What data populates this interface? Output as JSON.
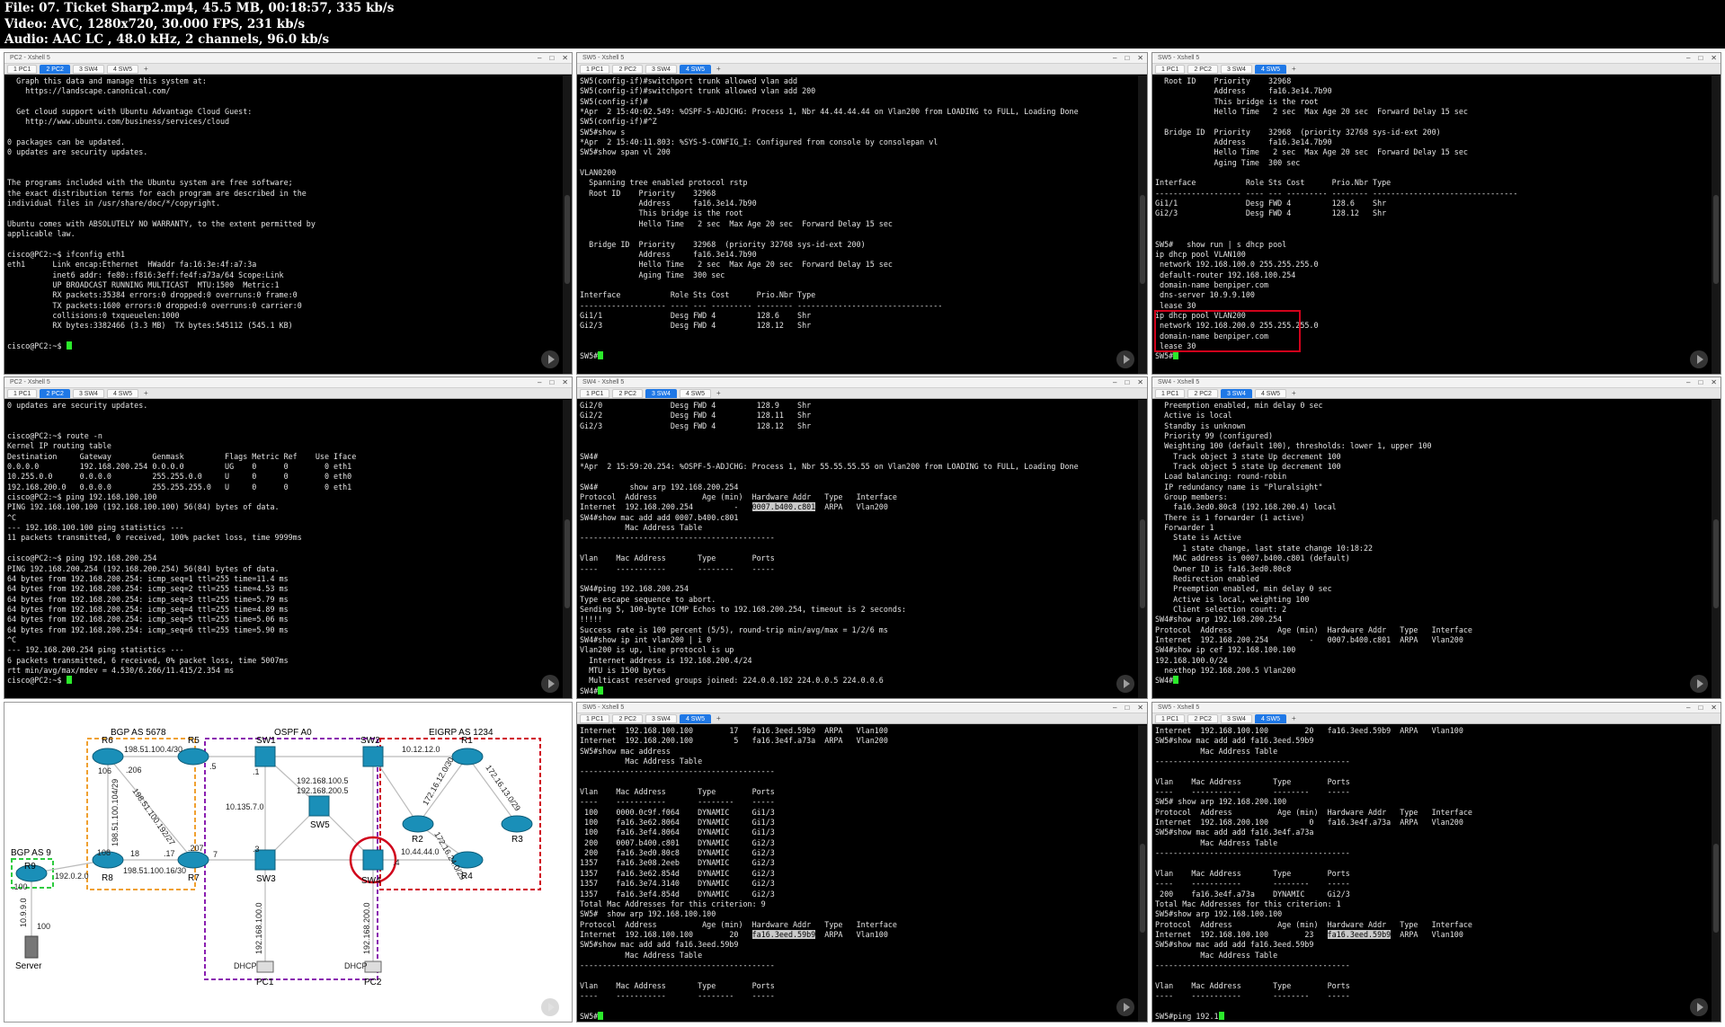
{
  "file_info": [
    "File: 07. Ticket Sharp2.mp4, 45.5 MB, 00:18:57, 335 kb/s",
    "Video: AVC, 1280x720, 30.000 FPS, 231 kb/s",
    "Audio: AAC LC , 48.0 kHz, 2 channels, 96.0 kb/s"
  ],
  "panes": [
    {
      "title": "PC2 - Xshell 5",
      "tabs": [
        "1 PC1",
        "2 PC2",
        "3 SW4",
        "4 SW5"
      ],
      "active_tab": 1,
      "lines": [
        "  Graph this data and manage this system at:",
        "    https://landscape.canonical.com/",
        "",
        "  Get cloud support with Ubuntu Advantage Cloud Guest:",
        "    http://www.ubuntu.com/business/services/cloud",
        "",
        "0 packages can be updated.",
        "0 updates are security updates.",
        "",
        "",
        "The programs included with the Ubuntu system are free software;",
        "the exact distribution terms for each program are described in the",
        "individual files in /usr/share/doc/*/copyright.",
        "",
        "Ubuntu comes with ABSOLUTELY NO WARRANTY, to the extent permitted by",
        "applicable law.",
        "",
        "cisco@PC2:~$ ifconfig eth1",
        "eth1      Link encap:Ethernet  HWaddr fa:16:3e:4f:a7:3a",
        "          inet6 addr: fe80::f816:3eff:fe4f:a73a/64 Scope:Link",
        "          UP BROADCAST RUNNING MULTICAST  MTU:1500  Metric:1",
        "          RX packets:35384 errors:0 dropped:0 overruns:0 frame:0",
        "          TX packets:1600 errors:0 dropped:0 overruns:0 carrier:0",
        "          collisions:0 txqueuelen:1000",
        "          RX bytes:3382466 (3.3 MB)  TX bytes:545112 (545.1 KB)",
        "",
        "cisco@PC2:~$ "
      ]
    },
    {
      "title": "SW5 - Xshell 5",
      "tabs": [
        "1 PC1",
        "2 PC2",
        "3 SW4",
        "4 SW5"
      ],
      "active_tab": 3,
      "lines": [
        "SW5(config-if)#switchport trunk allowed vlan add",
        "SW5(config-if)#switchport trunk allowed vlan add 200",
        "SW5(config-if)#",
        "*Apr  2 15:40:02.549: %OSPF-5-ADJCHG: Process 1, Nbr 44.44.44.44 on Vlan200 from LOADING to FULL, Loading Done",
        "SW5(config-if)#^Z",
        "SW5#show s",
        "*Apr  2 15:40:11.803: %SYS-5-CONFIG_I: Configured from console by consolepan vl",
        "SW5#show span vl 200",
        "",
        "VLAN0200",
        "  Spanning tree enabled protocol rstp",
        "  Root ID    Priority    32968",
        "             Address     fa16.3e14.7b90",
        "             This bridge is the root",
        "             Hello Time   2 sec  Max Age 20 sec  Forward Delay 15 sec",
        "",
        "  Bridge ID  Priority    32968  (priority 32768 sys-id-ext 200)",
        "             Address     fa16.3e14.7b90",
        "             Hello Time   2 sec  Max Age 20 sec  Forward Delay 15 sec",
        "             Aging Time  300 sec",
        "",
        "Interface           Role Sts Cost      Prio.Nbr Type",
        "------------------- ---- --- --------- -------- --------------------------------",
        "Gi1/1               Desg FWD 4         128.6    Shr",
        "Gi2/3               Desg FWD 4         128.12   Shr",
        "",
        "",
        "SW5#"
      ]
    },
    {
      "title": "SW5 - Xshell 5",
      "tabs": [
        "1 PC1",
        "2 PC2",
        "3 SW4",
        "4 SW5"
      ],
      "active_tab": 3,
      "lines": [
        "  Root ID    Priority    32968",
        "             Address     fa16.3e14.7b90",
        "             This bridge is the root",
        "             Hello Time   2 sec  Max Age 20 sec  Forward Delay 15 sec",
        "",
        "  Bridge ID  Priority    32968  (priority 32768 sys-id-ext 200)",
        "             Address     fa16.3e14.7b90",
        "             Hello Time   2 sec  Max Age 20 sec  Forward Delay 15 sec",
        "             Aging Time  300 sec",
        "",
        "Interface           Role Sts Cost      Prio.Nbr Type",
        "------------------- ---- --- --------- -------- --------------------------------",
        "Gi1/1               Desg FWD 4         128.6    Shr",
        "Gi2/3               Desg FWD 4         128.12   Shr",
        "",
        "",
        "SW5#   show run | s dhcp pool",
        "ip dhcp pool VLAN100",
        " network 192.168.100.0 255.255.255.0",
        " default-router 192.168.100.254",
        " domain-name benpiper.com",
        " dns-server 10.9.9.100",
        " lease 30",
        "ip dhcp pool VLAN200",
        " network 192.168.200.0 255.255.255.0",
        " domain-name benpiper.com",
        " lease 30",
        "SW5#"
      ]
    },
    {
      "title": "PC2 - Xshell 5",
      "tabs": [
        "1 PC1",
        "2 PC2",
        "3 SW4",
        "4 SW5"
      ],
      "active_tab": 1,
      "lines": [
        "0 updates are security updates.",
        "",
        "",
        "cisco@PC2:~$ route -n",
        "Kernel IP routing table",
        "Destination     Gateway         Genmask         Flags Metric Ref    Use Iface",
        "0.0.0.0         192.168.200.254 0.0.0.0         UG    0      0        0 eth1",
        "10.255.0.0      0.0.0.0         255.255.0.0     U     0      0        0 eth0",
        "192.168.200.0   0.0.0.0         255.255.255.0   U     0      0        0 eth1",
        "cisco@PC2:~$ ping 192.168.100.100",
        "PING 192.168.100.100 (192.168.100.100) 56(84) bytes of data.",
        "^C",
        "--- 192.168.100.100 ping statistics ---",
        "11 packets transmitted, 0 received, 100% packet loss, time 9999ms",
        "",
        "cisco@PC2:~$ ping 192.168.200.254",
        "PING 192.168.200.254 (192.168.200.254) 56(84) bytes of data.",
        "64 bytes from 192.168.200.254: icmp_seq=1 ttl=255 time=11.4 ms",
        "64 bytes from 192.168.200.254: icmp_seq=2 ttl=255 time=4.53 ms",
        "64 bytes from 192.168.200.254: icmp_seq=3 ttl=255 time=5.79 ms",
        "64 bytes from 192.168.200.254: icmp_seq=4 ttl=255 time=4.89 ms",
        "64 bytes from 192.168.200.254: icmp_seq=5 ttl=255 time=5.06 ms",
        "64 bytes from 192.168.200.254: icmp_seq=6 ttl=255 time=5.90 ms",
        "^C",
        "--- 192.168.200.254 ping statistics ---",
        "6 packets transmitted, 6 received, 0% packet loss, time 5007ms",
        "rtt min/avg/max/mdev = 4.530/6.266/11.415/2.354 ms",
        "cisco@PC2:~$ "
      ]
    },
    {
      "title": "SW4 - Xshell 5",
      "tabs": [
        "1 PC1",
        "2 PC2",
        "3 SW4",
        "4 SW5"
      ],
      "active_tab": 2,
      "lines": [
        "Gi2/0               Desg FWD 4         128.9    Shr",
        "Gi2/2               Desg FWD 4         128.11   Shr",
        "Gi2/3               Desg FWD 4         128.12   Shr",
        "",
        "",
        "SW4#",
        "*Apr  2 15:59:20.254: %OSPF-5-ADJCHG: Process 1, Nbr 55.55.55.55 on Vlan200 from LOADING to FULL, Loading Done",
        "",
        "SW4#       show arp 192.168.200.254",
        "Protocol  Address          Age (min)  Hardware Addr   Type   Interface",
        "Internet  192.168.200.254         -   0007.b400.c801  ARPA   Vlan200",
        "SW4#show mac add add 0007.b400.c801",
        "          Mac Address Table",
        "-------------------------------------------",
        "",
        "Vlan    Mac Address       Type        Ports",
        "----    -----------       --------    -----",
        "",
        "SW4#ping 192.168.200.254",
        "Type escape sequence to abort.",
        "Sending 5, 100-byte ICMP Echos to 192.168.200.254, timeout is 2 seconds:",
        "!!!!!",
        "Success rate is 100 percent (5/5), round-trip min/avg/max = 1/2/6 ms",
        "SW4#show ip int vlan200 | i 0",
        "Vlan200 is up, line protocol is up",
        "  Internet address is 192.168.200.4/24",
        "  MTU is 1500 bytes",
        "  Multicast reserved groups joined: 224.0.0.102 224.0.0.5 224.0.0.6",
        "SW4#"
      ]
    },
    {
      "title": "SW4 - Xshell 5",
      "tabs": [
        "1 PC1",
        "2 PC2",
        "3 SW4",
        "4 SW5"
      ],
      "active_tab": 2,
      "lines": [
        "  Preemption enabled, min delay 0 sec",
        "  Active is local",
        "  Standby is unknown",
        "  Priority 99 (configured)",
        "  Weighting 100 (default 100), thresholds: lower 1, upper 100",
        "    Track object 3 state Up decrement 100",
        "    Track object 5 state Up decrement 100",
        "  Load balancing: round-robin",
        "  IP redundancy name is \"Pluralsight\"",
        "  Group members:",
        "    fa16.3ed0.80c8 (192.168.200.4) local",
        "  There is 1 forwarder (1 active)",
        "  Forwarder 1",
        "    State is Active",
        "      1 state change, last state change 10:18:22",
        "    MAC address is 0007.b400.c801 (default)",
        "    Owner ID is fa16.3ed0.80c8",
        "    Redirection enabled",
        "    Preemption enabled, min delay 0 sec",
        "    Active is local, weighting 100",
        "    Client selection count: 2",
        "SW4#show arp 192.168.200.254",
        "Protocol  Address          Age (min)  Hardware Addr   Type   Interface",
        "Internet  192.168.200.254         -   0007.b400.c801  ARPA   Vlan200",
        "SW4#show ip cef 192.168.100.100",
        "192.168.100.0/24",
        "  nexthop 192.168.200.5 Vlan200",
        "SW4#"
      ]
    },
    {
      "title": "SW5 - Xshell 5",
      "tabs": [
        "1 PC1",
        "2 PC2",
        "3 SW4",
        "4 SW5"
      ],
      "active_tab": 3,
      "lines": [
        "Internet  192.168.100.100        17   fa16.3eed.59b9  ARPA   Vlan100",
        "Internet  192.168.200.100         5   fa16.3e4f.a73a  ARPA   Vlan200",
        "SW5#show mac address",
        "          Mac Address Table",
        "-------------------------------------------",
        "",
        "Vlan    Mac Address       Type        Ports",
        "----    -----------       --------    -----",
        " 100    0000.0c9f.f064    DYNAMIC     Gi1/3",
        " 100    fa16.3e62.8064    DYNAMIC     Gi1/3",
        " 100    fa16.3ef4.8064    DYNAMIC     Gi1/3",
        " 200    0007.b400.c801    DYNAMIC     Gi2/3",
        " 200    fa16.3ed0.80c8    DYNAMIC     Gi2/3",
        "1357    fa16.3e08.2eeb    DYNAMIC     Gi2/3",
        "1357    fa16.3e62.854d    DYNAMIC     Gi2/3",
        "1357    fa16.3e74.3140    DYNAMIC     Gi2/3",
        "1357    fa16.3ef4.854d    DYNAMIC     Gi2/3",
        "Total Mac Addresses for this criterion: 9",
        "SW5#  show arp 192.168.100.100",
        "Protocol  Address          Age (min)  Hardware Addr   Type   Interface",
        "Internet  192.168.100.100        20   fa16.3eed.59b9  ARPA   Vlan100",
        "SW5#show mac add add fa16.3eed.59b9",
        "          Mac Address Table",
        "-------------------------------------------",
        "",
        "Vlan    Mac Address       Type        Ports",
        "----    -----------       --------    -----",
        "",
        "SW5#"
      ]
    },
    {
      "title": "SW5 - Xshell 5",
      "tabs": [
        "1 PC1",
        "2 PC2",
        "3 SW4",
        "4 SW5"
      ],
      "active_tab": 3,
      "lines": [
        "Internet  192.168.100.100        20   fa16.3eed.59b9  ARPA   Vlan100",
        "SW5#show mac add add fa16.3eed.59b9",
        "          Mac Address Table",
        "-------------------------------------------",
        "",
        "Vlan    Mac Address       Type        Ports",
        "----    -----------       --------    -----",
        "SW5# show arp 192.168.200.100",
        "Protocol  Address          Age (min)  Hardware Addr   Type   Interface",
        "Internet  192.168.200.100         0   fa16.3e4f.a73a  ARPA   Vlan200",
        "SW5#show mac add add fa16.3e4f.a73a",
        "          Mac Address Table",
        "-------------------------------------------",
        "",
        "Vlan    Mac Address       Type        Ports",
        "----    -----------       --------    -----",
        " 200    fa16.3e4f.a73a    DYNAMIC     Gi2/3",
        "Total Mac Addresses for this criterion: 1",
        "SW5#show arp 192.168.100.100",
        "Protocol  Address          Age (min)  Hardware Addr   Type   Interface",
        "Internet  192.168.100.100        23   fa16.3eed.59b9  ARPA   Vlan100",
        "SW5#show mac add add fa16.3eed.59b9",
        "          Mac Address Table",
        "-------------------------------------------",
        "",
        "Vlan    Mac Address       Type        Ports",
        "----    -----------       --------    -----",
        "",
        "SW5#ping 192.1"
      ]
    }
  ],
  "highlights": [
    {
      "pane": 4,
      "line": 10,
      "text": "0007.b400.c801"
    },
    {
      "pane": 6,
      "line": 20,
      "text": "fa16.3eed.59b9"
    },
    {
      "pane": 7,
      "line": 20,
      "text": "fa16.3eed.59b9"
    }
  ],
  "diagram": {
    "areas": [
      {
        "label": "BGP AS 5678",
        "color": "#f0a030"
      },
      {
        "label": "OSPF A0",
        "color": "#8a1fb0"
      },
      {
        "label": "EIGRP AS 1234",
        "color": "#d0021b"
      },
      {
        "label": "BGP AS 9",
        "color": "#2ecc40"
      }
    ],
    "devices": [
      {
        "name": "R6",
        "kind": "router"
      },
      {
        "name": "R5",
        "kind": "router"
      },
      {
        "name": "R8",
        "kind": "router"
      },
      {
        "name": "R7",
        "kind": "router"
      },
      {
        "name": "R9",
        "kind": "router"
      },
      {
        "name": "SW1",
        "kind": "switch"
      },
      {
        "name": "SW2",
        "kind": "switch"
      },
      {
        "name": "SW3",
        "kind": "switch"
      },
      {
        "name": "SW4",
        "kind": "switch"
      },
      {
        "name": "SW5",
        "kind": "switch"
      },
      {
        "name": "R1",
        "kind": "router"
      },
      {
        "name": "R2",
        "kind": "router"
      },
      {
        "name": "R3",
        "kind": "router"
      },
      {
        "name": "R4",
        "kind": "router"
      },
      {
        "name": "PC1",
        "kind": "pc"
      },
      {
        "name": "PC2",
        "kind": "pc"
      },
      {
        "name": "Server",
        "kind": "server"
      }
    ],
    "labels": [
      "198.51.100.4/30",
      ".206",
      "106",
      ".5",
      "198.51.100.104/29",
      "198.51.100.192/27",
      "108",
      "18",
      ".17",
      ".207",
      "7",
      "198.51.100.16/30",
      "192.0.2.0",
      "10.9.9.0",
      ".100",
      "100",
      "10.135.7.0",
      ".1",
      ".3",
      "192.168.100.5",
      "192.168.200.5",
      "10.12.12.0",
      "172.16.12.0/30",
      "172.16.13.0/29",
      "172.16.24.0/29",
      "10.44.44.0",
      ".4",
      "192.168.100.0",
      "192.168.200.0",
      "DHCP",
      "DHCP"
    ]
  }
}
